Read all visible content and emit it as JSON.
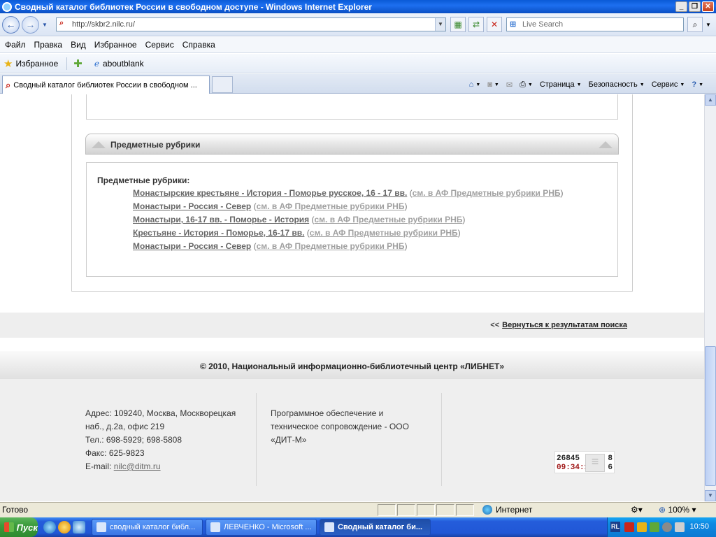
{
  "window": {
    "title": "Сводный каталог библиотек России в свободном доступе - Windows Internet Explorer",
    "minimize": "_",
    "maximize": "❐",
    "close": "✕"
  },
  "address": {
    "url": "http://skbr2.nilc.ru/",
    "search_placeholder": "Live Search"
  },
  "menu": [
    "Файл",
    "Правка",
    "Вид",
    "Избранное",
    "Сервис",
    "Справка"
  ],
  "favorites": {
    "label": "Избранное",
    "items": [
      "aboutblank"
    ]
  },
  "tabs": [
    {
      "label": "Сводный каталог библиотек России в свободном ..."
    }
  ],
  "command_bar": {
    "page": "Страница",
    "safety": "Безопасность",
    "tools": "Сервис"
  },
  "content": {
    "section_title": "Предметные рубрики",
    "rubrics_label": "Предметные рубрики:",
    "rubrics": [
      {
        "main": "Монастырские крестьяне - История - Поморье русское, 16 - 17 вв.",
        "alt": "см. в АФ Предметные рубрики РНБ"
      },
      {
        "main": "Монастыри - Россия - Север",
        "alt": "см. в АФ Предметные рубрики РНБ"
      },
      {
        "main": "Монастыри, 16-17 вв. - Поморье - История",
        "alt": "см. в АФ Предметные рубрики РНБ"
      },
      {
        "main": "Крестьяне - История - Поморье, 16-17 вв.",
        "alt": "см. в АФ Предметные рубрики РНБ"
      },
      {
        "main": "Монастыри - Россия - Север",
        "alt": "см. в АФ Предметные рубрики РНБ"
      }
    ],
    "back_prefix": "<<",
    "back_link": "Вернуться к результатам поиска",
    "copyright": "© 2010, Национальный информационно-библиотечный центр «ЛИБНЕТ»"
  },
  "footer": {
    "address_lines": [
      "Адрес: 109240, Москва, Москворецкая",
      "наб., д.2а, офис 219",
      "Тел.: 698-5929; 698-5808",
      "Факс: 625-9823"
    ],
    "email_label": "E-mail:",
    "email": "nilc@ditm.ru",
    "support_lines": [
      "Программное обеспечение и",
      "техническое сопровождение - ООО",
      "«ДИТ-М»"
    ],
    "counter": {
      "visits": "26845",
      "time": "09:34:11",
      "right_top": "8",
      "right_bottom": "6"
    }
  },
  "status": {
    "text": "Готово",
    "zone": "Интернет",
    "zoom": "100%"
  },
  "taskbar": {
    "start": "Пуск",
    "buttons": [
      {
        "label": "сводный каталог библ...",
        "active": false
      },
      {
        "label": "ЛЕВЧЕНКО - Microsoft ...",
        "active": false
      },
      {
        "label": "Сводный каталог би...",
        "active": true
      }
    ],
    "lang": "RL",
    "clock": "10:50"
  }
}
